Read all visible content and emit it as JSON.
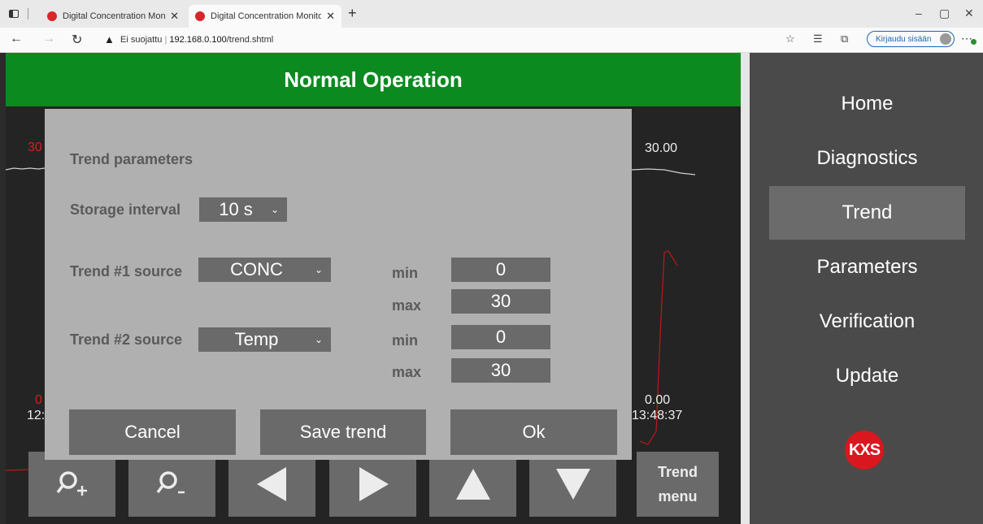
{
  "browser": {
    "tabs": [
      {
        "title": "Digital Concentration Monitor",
        "active": false
      },
      {
        "title": "Digital Concentration Monitor",
        "active": true
      }
    ],
    "new_tab": "+",
    "security_label": "Ei suojattu",
    "url_host": "192.168.0.100",
    "url_path": "/trend.shtml",
    "signin_label": "Kirjaudu sisään",
    "window_controls": [
      "–",
      "▢",
      "✕"
    ]
  },
  "app": {
    "status_text": "Normal Operation",
    "status_color": "#0a8a1f",
    "trend": {
      "left_top_label": "30",
      "left_bottom_label": "0",
      "left_time_label": "12:",
      "right_top_label": "30.00",
      "right_bottom_label": "0.00",
      "right_time_label": "13:48:37"
    },
    "sidebar": {
      "items": [
        {
          "label": "Home",
          "active": false
        },
        {
          "label": "Diagnostics",
          "active": false
        },
        {
          "label": "Trend",
          "active": true
        },
        {
          "label": "Parameters",
          "active": false
        },
        {
          "label": "Verification",
          "active": false
        },
        {
          "label": "Update",
          "active": false
        }
      ],
      "logo_text": "KXS"
    },
    "toolbar": {
      "buttons": [
        "zoom-in-icon",
        "zoom-out-icon",
        "arrow-left-icon",
        "arrow-right-icon",
        "arrow-up-icon",
        "arrow-down-icon"
      ],
      "trend_menu_line1": "Trend",
      "trend_menu_line2": "menu"
    }
  },
  "dialog": {
    "title": "Trend parameters",
    "storage_interval_label": "Storage interval",
    "storage_interval_value": "10 s",
    "trend1_label": "Trend #1 source",
    "trend1_value": "CONC",
    "trend1_min_label": "min",
    "trend1_min_value": "0",
    "trend1_max_label": "max",
    "trend1_max_value": "30",
    "trend2_label": "Trend #2 source",
    "trend2_value": "Temp",
    "trend2_min_label": "min",
    "trend2_min_value": "0",
    "trend2_max_label": "max",
    "trend2_max_value": "30",
    "buttons": {
      "cancel": "Cancel",
      "save": "Save trend",
      "ok": "Ok"
    }
  }
}
